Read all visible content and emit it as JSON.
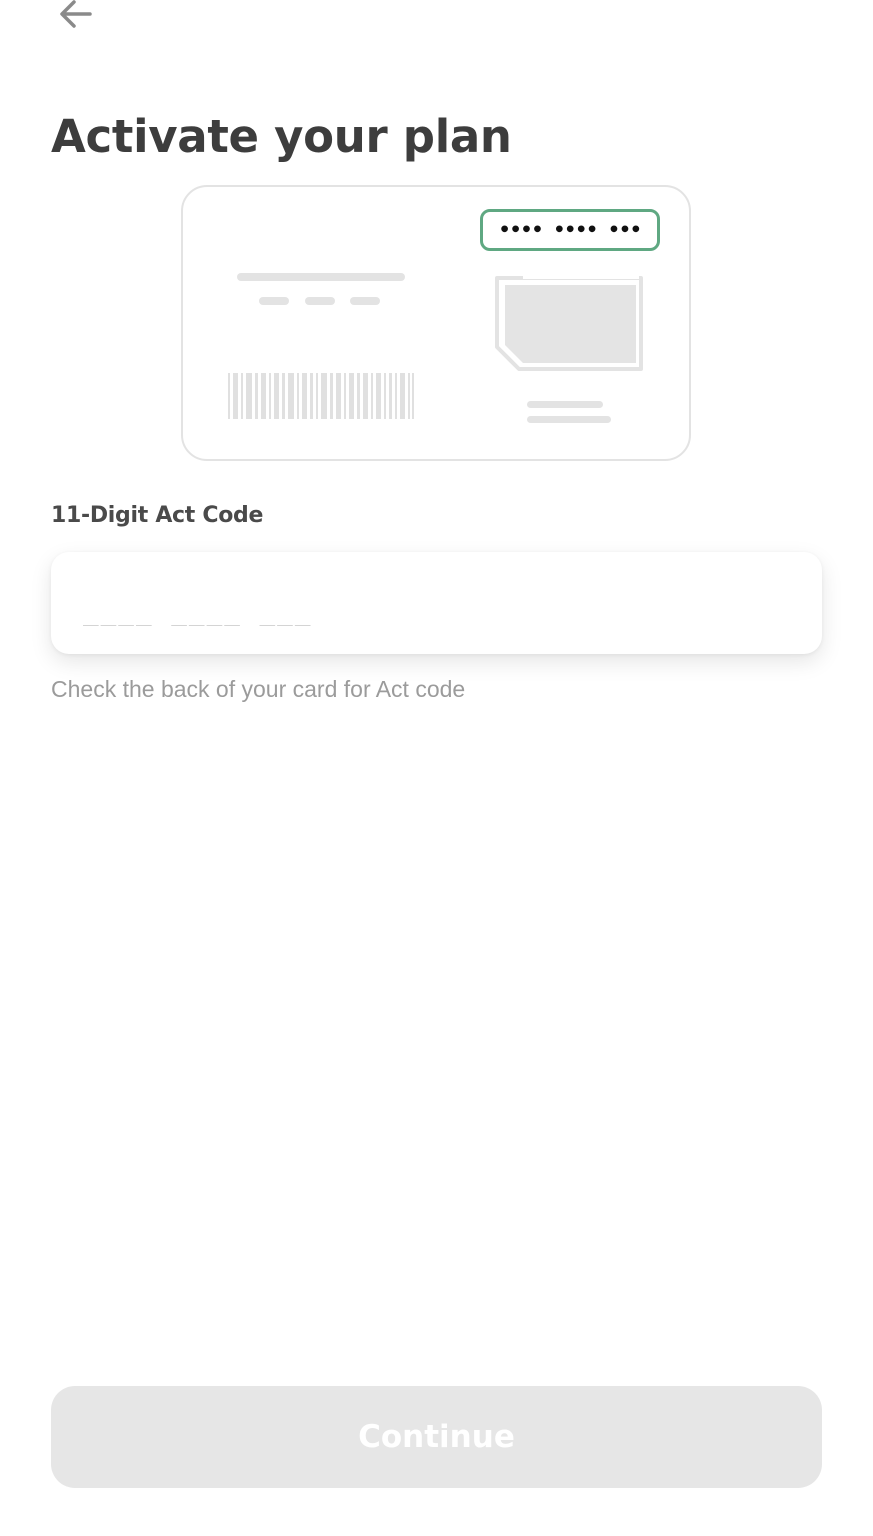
{
  "header": {
    "back_icon": "arrow-left-icon",
    "title": "Activate your plan"
  },
  "illustration": {
    "highlighted_code": "•••• •••• •••",
    "highlight_color": "#5fa882",
    "icons": [
      "barcode-icon",
      "sim-chip-icon"
    ]
  },
  "form": {
    "label": "11-Digit Act Code",
    "input_value": "",
    "input_placeholder": "____ ____ ___",
    "helper_text": "Check the back of your card for Act code"
  },
  "footer": {
    "continue_label": "Continue",
    "continue_enabled": false,
    "button_color": "#e6e6e6"
  }
}
